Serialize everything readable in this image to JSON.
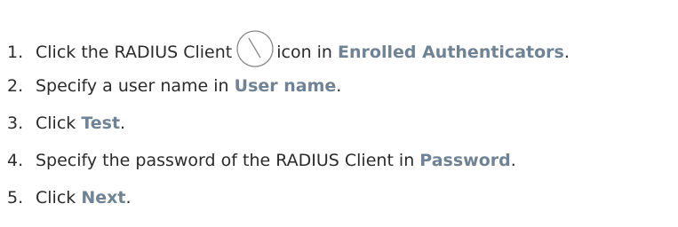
{
  "steps": [
    {
      "number": "1.",
      "text_before": "Click the RADIUS Client",
      "icon": "radius-client-gauge-icon",
      "text_middle": "icon in",
      "ui_label": "Enrolled Authenticators",
      "text_after": "."
    },
    {
      "number": "2.",
      "text_before": "Specify a user name in",
      "ui_label": "User name",
      "text_after": "."
    },
    {
      "number": "3.",
      "text_before": "Click",
      "ui_label": "Test",
      "text_after": "."
    },
    {
      "number": "4.",
      "text_before": "Specify the password of the RADIUS Client in",
      "ui_label": "Password",
      "text_after": "."
    },
    {
      "number": "5.",
      "text_before": "Click",
      "ui_label": "Next",
      "text_after": "."
    }
  ],
  "colors": {
    "text": "#2b2b2b",
    "ui_label": "#6f8394"
  }
}
